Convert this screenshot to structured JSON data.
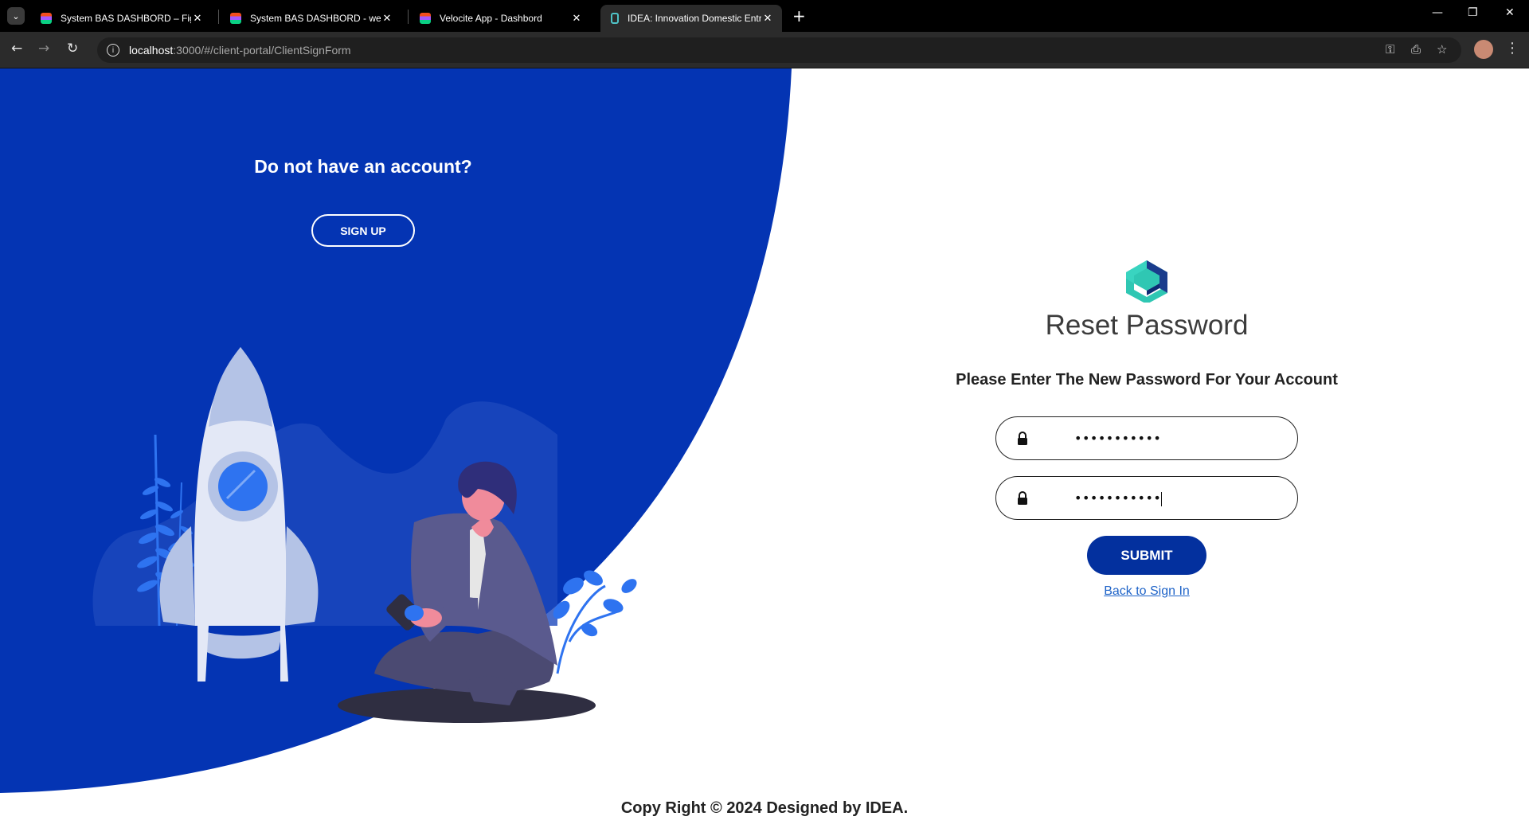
{
  "browser": {
    "tabs": [
      {
        "title": "System BAS DASHBORD – Figma",
        "favicon": "figma-icon"
      },
      {
        "title": "System BAS DASHBORD - web",
        "favicon": "figma-icon"
      },
      {
        "title": "Velocite App - Dashbord",
        "favicon": "figma-icon"
      },
      {
        "title": "IDEA: Innovation Domestic Entr",
        "favicon": "idea-icon",
        "active": true
      }
    ],
    "new_tab": "+",
    "close": "✕",
    "url_host": "localhost",
    "url_path": ":3000/#/client-portal/ClientSignForm"
  },
  "left_panel": {
    "heading": "Do not have an account?",
    "signup_label": "SIGN UP",
    "bg_color": "#0434b3"
  },
  "form": {
    "title": "Reset Password",
    "subtitle": "Please Enter The New Password For Your Account",
    "new_password_value": "•••••••••••",
    "confirm_password_value": "•••••••••••",
    "submit_label": "SUBMIT",
    "back_link": "Back to Sign In",
    "accent_color": "#03309e"
  },
  "footer": {
    "copyright": "Copy Right © 2024 Designed by IDEA."
  }
}
